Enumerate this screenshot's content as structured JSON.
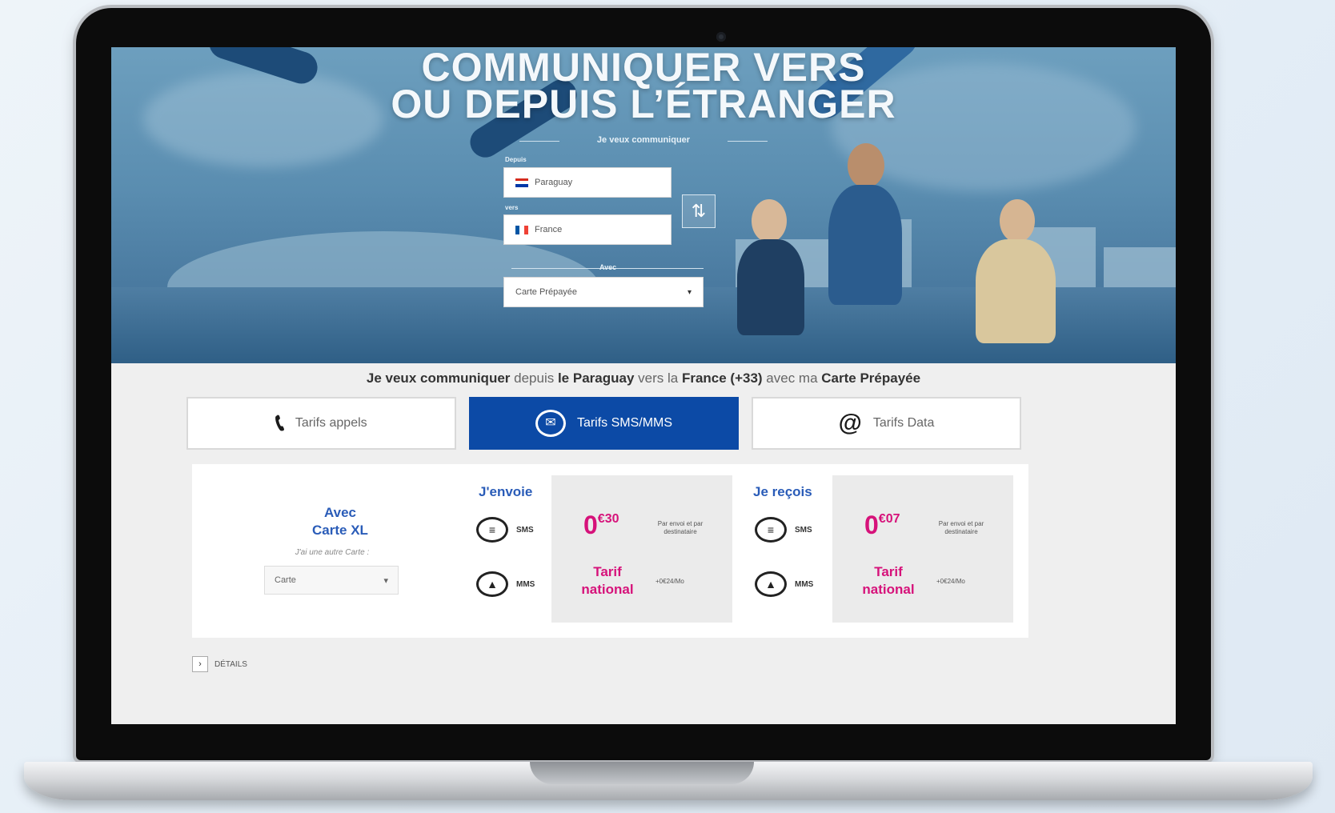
{
  "hero": {
    "title_line1": "COMMUNIQUER VERS",
    "title_line2": "OU DEPUIS L’ÉTRANGER",
    "subtitle": "Je veux communiquer",
    "from_label": "Depuis",
    "to_label": "vers",
    "from_country": "Paraguay",
    "to_country": "France",
    "with_label": "Avec",
    "offer_select": "Carte Prépayée",
    "swap_icon": "swap-arrows"
  },
  "summary": {
    "part1": "Je veux communiquer",
    "part2": " depuis ",
    "part3": "le Paraguay",
    "part4": " vers la ",
    "part5": "France (+33)",
    "part6": " avec ma ",
    "part7": "Carte Prépayée"
  },
  "tabs": [
    {
      "label": "Tarifs appels",
      "icon": "phone-icon"
    },
    {
      "label": "Tarifs SMS/MMS",
      "icon": "sms-icon",
      "active": true
    },
    {
      "label": "Tarifs Data",
      "icon": "at-icon"
    }
  ],
  "panel": {
    "avec_line1": "Avec",
    "avec_line2": "Carte XL",
    "other_card": "J'ai une autre Carte :",
    "card_select": "Carte",
    "send": {
      "title": "J'envoie",
      "sms": "SMS",
      "mms": "MMS",
      "price_int": "0",
      "price_dec": "€30",
      "price_note": "Par envoi et par destinataire",
      "tarif_line1": "Tarif",
      "tarif_line2": "national",
      "tarif_note": "+0€24/Mo"
    },
    "receive": {
      "title": "Je reçois",
      "sms": "SMS",
      "mms": "MMS",
      "price_int": "0",
      "price_dec": "€07",
      "price_note": "Par envoi et par destinataire",
      "tarif_line1": "Tarif",
      "tarif_line2": "national",
      "tarif_note": "+0€24/Mo"
    }
  },
  "details": {
    "label": "DÉTAILS"
  },
  "colors": {
    "accent_blue": "#0c4aa6",
    "price_pink": "#d6127a",
    "heading_blue": "#2a5cb8"
  }
}
